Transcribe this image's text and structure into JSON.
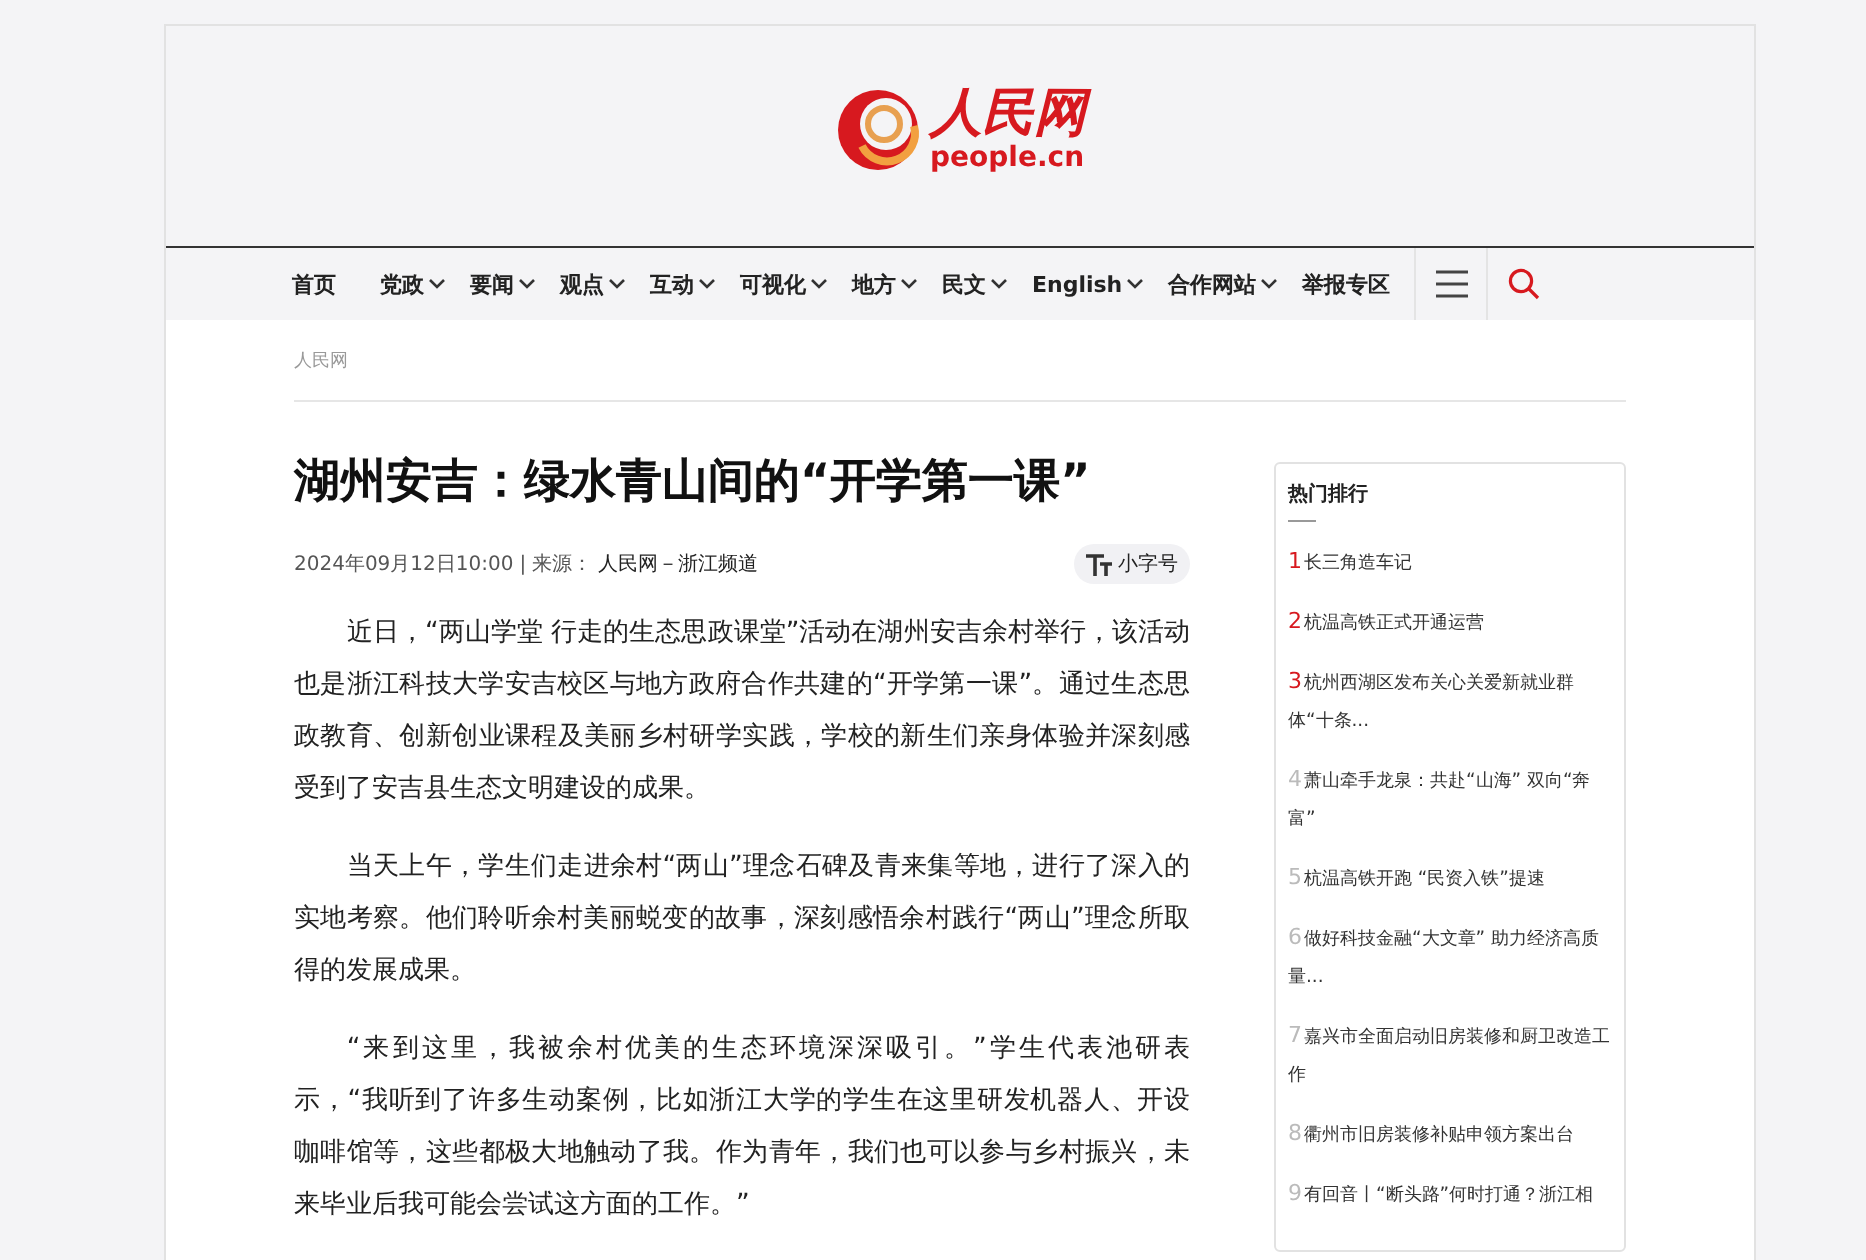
{
  "logo": {
    "name": "人民网",
    "domain": "people.cn"
  },
  "nav": [
    {
      "label": "首页",
      "dropdown": false
    },
    {
      "label": "党政",
      "dropdown": true
    },
    {
      "label": "要闻",
      "dropdown": true
    },
    {
      "label": "观点",
      "dropdown": true
    },
    {
      "label": "互动",
      "dropdown": true
    },
    {
      "label": "可视化",
      "dropdown": true
    },
    {
      "label": "地方",
      "dropdown": true
    },
    {
      "label": "民文",
      "dropdown": true
    },
    {
      "label": "English",
      "dropdown": true
    },
    {
      "label": "合作网站",
      "dropdown": true
    },
    {
      "label": "举报专区",
      "dropdown": false
    }
  ],
  "breadcrumb": "人民网",
  "article": {
    "title": "湖州安吉：绿水青山间的“开学第一课”",
    "date": "2024年09月12日10:00",
    "separator": "|",
    "source_label": "来源：",
    "source": "人民网－浙江频道",
    "font_size_button": "小字号",
    "paragraphs": [
      "近日，“两山学堂 行走的生态思政课堂”活动在湖州安吉余村举行，该活动也是浙江科技大学安吉校区与地方政府合作共建的“开学第一课”。通过生态思政教育、创新创业课程及美丽乡村研学实践，学校的新生们亲身体验并深刻感受到了安吉县生态文明建设的成果。",
      "当天上午，学生们走进余村“两山”理念石碑及青来集等地，进行了深入的实地考察。他们聆听余村美丽蜕变的故事，深刻感悟余村践行“两山”理念所取得的发展成果。",
      "“来到这里，我被余村优美的生态环境深深吸引。”学生代表池研表示，“我听到了许多生动案例，比如浙江大学的学生在这里研发机器人、开设咖啡馆等，这些都极大地触动了我。作为青年，我们也可以参与乡村振兴，未来毕业后我可能会尝试这方面的工作。”"
    ]
  },
  "hot_list": {
    "title": "热门排行",
    "items": [
      {
        "rank": "1",
        "text": "长三角造车记",
        "top": true
      },
      {
        "rank": "2",
        "text": "杭温高铁正式开通运营",
        "top": true
      },
      {
        "rank": "3",
        "text": "杭州西湖区发布关心关爱新就业群体“十条...",
        "top": true
      },
      {
        "rank": "4",
        "text": "萧山牵手龙泉：共赴“山海” 双向“奔富”",
        "top": false
      },
      {
        "rank": "5",
        "text": "杭温高铁开跑 “民资入铁”提速",
        "top": false
      },
      {
        "rank": "6",
        "text": "做好科技金融“大文章” 助力经济高质量...",
        "top": false
      },
      {
        "rank": "7",
        "text": "嘉兴市全面启动旧房装修和厨卫改造工作",
        "top": false
      },
      {
        "rank": "8",
        "text": "衢州市旧房装修补贴申领方案出台",
        "top": false
      },
      {
        "rank": "9",
        "text": "有回音丨“断头路”何时打通？浙江相",
        "top": false
      }
    ]
  }
}
